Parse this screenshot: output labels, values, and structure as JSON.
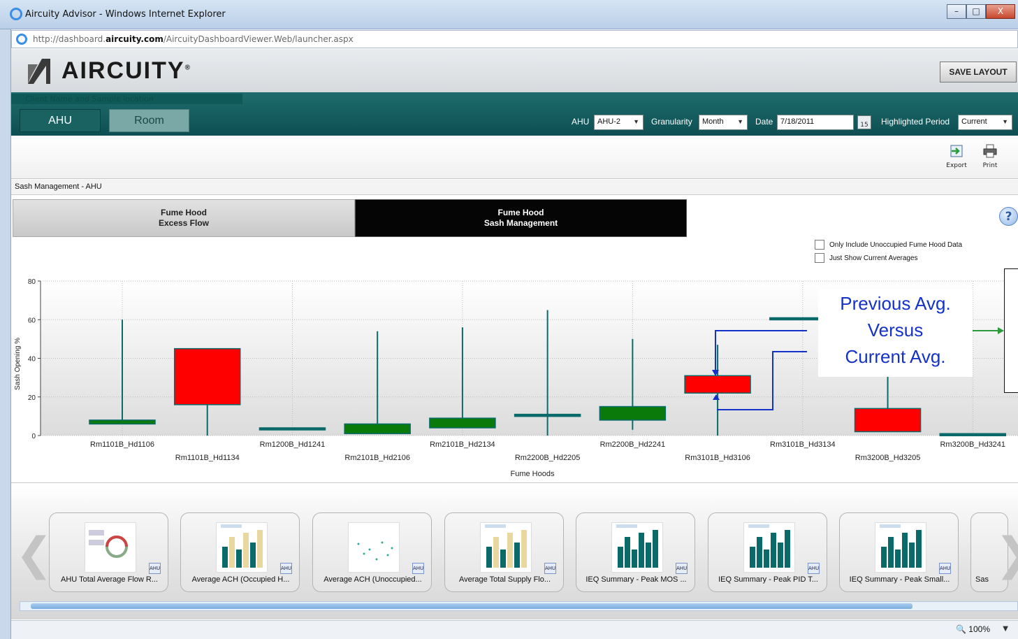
{
  "window": {
    "title": "Aircuity Advisor - Windows Internet Explorer",
    "url_prefix": "http://dashboard.",
    "url_domain": "aircuity.com",
    "url_suffix": "/AircuityDashboardViewer.Web/launcher.aspx",
    "controls": [
      "–",
      "□",
      "X"
    ]
  },
  "app": {
    "logo_text": "AIRCUITY",
    "logo_registered": "®",
    "save_layout": "SAVE LAYOUT",
    "client_placeholder": "Client Name and Sample location"
  },
  "nav": {
    "tab_ahu": "AHU",
    "tab_room": "Room",
    "ahu_label": "AHU",
    "ahu_value": "AHU-2",
    "granularity_label": "Granularity",
    "granularity_value": "Month",
    "date_label": "Date",
    "date_value": "7/18/2011",
    "calendar_day": "15",
    "period_label": "Highlighted Period",
    "period_value": "Current"
  },
  "toolbar": {
    "export": "Export",
    "print": "Print"
  },
  "panel": {
    "title": "Sash Management - AHU",
    "tab_excess_line1": "Fume Hood",
    "tab_excess_line2": "Excess Flow",
    "tab_sash_line1": "Fume Hood",
    "tab_sash_line2": "Sash Management",
    "help": "?",
    "checkbox_unoccupied": "Only Include Unoccupied Fume Hood Data",
    "checkbox_current": "Just Show Current Averages"
  },
  "callout": {
    "line1": "Previous Avg.",
    "line2": "Versus",
    "line3": "Current Avg."
  },
  "chart_data": {
    "type": "bar",
    "xlabel": "Fume Hoods",
    "ylabel": "Sash Opening %",
    "ylim": [
      0,
      80
    ],
    "yticks": [
      0,
      20,
      40,
      60,
      80
    ],
    "grid": true,
    "categories": [
      "Rm1101B_Hd1106",
      "Rm1101B_Hd1134",
      "Rm1200B_Hd1241",
      "Rm2101B_Hd2106",
      "Rm2101B_Hd2134",
      "Rm2200B_Hd2205",
      "Rm2200B_Hd2241",
      "Rm3101B_Hd3106",
      "Rm3101B_Hd3134",
      "Rm3200B_Hd3205",
      "Rm3200B_Hd3241"
    ],
    "series": [
      {
        "values_low": [
          6,
          16,
          4,
          1,
          4,
          10,
          8,
          22,
          61,
          2,
          1
        ]
      },
      {
        "values_high": [
          8,
          45,
          4,
          6,
          9,
          11,
          15,
          31,
          61,
          14,
          1
        ]
      },
      {
        "values_max": [
          60,
          45,
          4,
          54,
          56,
          65,
          50,
          47,
          61,
          41,
          1
        ]
      },
      {
        "values_min": [
          6,
          0,
          4,
          1,
          4,
          0,
          3,
          0,
          61,
          2,
          1
        ]
      }
    ],
    "bar_colors": [
      "#0a7a0a",
      "#ff0000",
      "#0a6a6a",
      "#0a7a0a",
      "#0a7a0a",
      "#0a6a6a",
      "#0a7a0a",
      "#ff0000",
      "#0a6a6a",
      "#ff0000",
      "#0a6a6a"
    ]
  },
  "dock": {
    "items": [
      "AHU Total Average Flow R...",
      "Average ACH (Occupied H...",
      "Average ACH (Unoccupied...",
      "Average Total Supply Flo...",
      "IEQ Summary - Peak MOS ...",
      "IEQ Summary - Peak PID T...",
      "IEQ Summary - Peak Small...",
      "Sas"
    ],
    "badge": "AHU"
  },
  "status": {
    "zoom": "100%"
  }
}
